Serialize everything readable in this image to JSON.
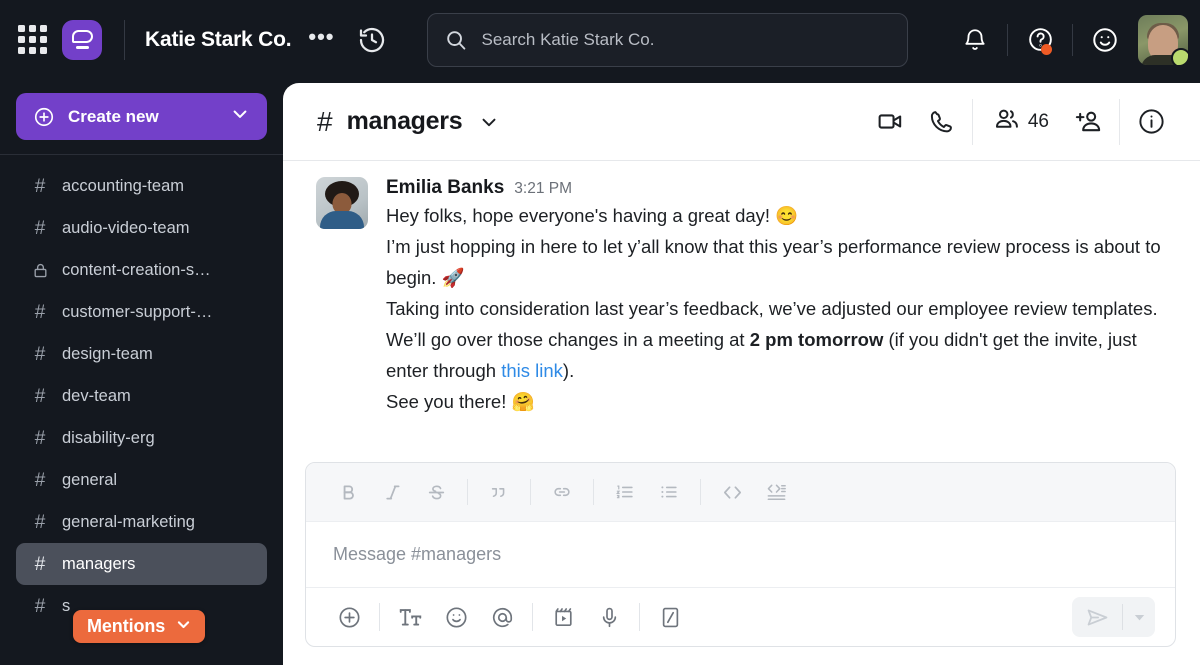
{
  "topbar": {
    "apps_icon": "grid-apps-icon",
    "logo_icon": "brand-chat-logo",
    "org_title": "Katie Stark Co.",
    "more_label": "•••",
    "history_icon": "history-clock-icon",
    "search": {
      "icon": "search-icon",
      "placeholder": "Search Katie Stark Co."
    },
    "notifications_icon": "bell-icon",
    "help_icon": "help-circle-icon",
    "help_has_badge": true,
    "emoji_status_icon": "smiley-face-icon",
    "avatar_icon": "user-avatar",
    "presence_status": "online"
  },
  "sidebar": {
    "create_new": {
      "label": "Create new",
      "plus_icon": "plus-circle-icon",
      "caret_icon": "chevron-down-icon",
      "color": "#7340c9"
    },
    "channels": [
      {
        "name": "accounting-team",
        "icon": "hash-icon",
        "active": false
      },
      {
        "name": "audio-video-team",
        "icon": "hash-icon",
        "active": false
      },
      {
        "name": "content-creation-s…",
        "icon": "lock-icon",
        "active": false
      },
      {
        "name": "customer-support-…",
        "icon": "hash-icon",
        "active": false
      },
      {
        "name": "design-team",
        "icon": "hash-icon",
        "active": false
      },
      {
        "name": "dev-team",
        "icon": "hash-icon",
        "active": false
      },
      {
        "name": "disability-erg",
        "icon": "hash-icon",
        "active": false
      },
      {
        "name": "general",
        "icon": "hash-icon",
        "active": false
      },
      {
        "name": "general-marketing",
        "icon": "hash-icon",
        "active": false
      },
      {
        "name": "managers",
        "icon": "hash-icon",
        "active": true
      },
      {
        "name": "s",
        "icon": "hash-icon",
        "active": false
      }
    ],
    "mentions_pill": {
      "label": "Mentions",
      "caret_icon": "chevron-down-icon",
      "color": "#ec6a3d"
    }
  },
  "channel_header": {
    "hash": "#",
    "name": "managers",
    "caret_icon": "chevron-down-icon",
    "video_icon": "video-camera-icon",
    "call_icon": "phone-icon",
    "members_icon": "people-icon",
    "member_count": "46",
    "add_member_icon": "add-person-icon",
    "info_icon": "info-circle-icon"
  },
  "message": {
    "author": "Emilia Banks",
    "time": "3:21 PM",
    "avatar_icon": "user-avatar",
    "lines": [
      "Hey folks, hope everyone's having a great day! 😊",
      "I’m just hopping in here to let y’all know that this year’s performance review process is about to begin. 🚀",
      "Taking into consideration last year’s feedback, we’ve adjusted our employee review templates. We’ll go over those changes in a meeting at ",
      "2 pm tomorrow",
      " (if you didn't get the invite, just enter through ",
      "this link",
      ").",
      "See you there! 🤗"
    ],
    "link_text": "this link",
    "bold_text": "2 pm tomorrow",
    "link_color": "#2e8ae6"
  },
  "composer": {
    "placeholder": "Message #managers",
    "format_tools": [
      {
        "name": "bold-icon",
        "label": "B"
      },
      {
        "name": "italic-icon",
        "label": "I"
      },
      {
        "name": "strikethrough-icon",
        "label": "S"
      },
      {
        "name": "blockquote-icon",
        "label": "❞"
      },
      {
        "name": "link-icon",
        "label": "🔗"
      },
      {
        "name": "ordered-list-icon",
        "label": "1."
      },
      {
        "name": "bulleted-list-icon",
        "label": "•"
      },
      {
        "name": "inline-code-icon",
        "label": "<>"
      },
      {
        "name": "code-block-icon",
        "label": "</>"
      }
    ],
    "action_tools": [
      {
        "name": "attach-plus-icon"
      },
      {
        "name": "text-format-icon"
      },
      {
        "name": "emoji-icon"
      },
      {
        "name": "mention-icon"
      },
      {
        "name": "video-clip-icon"
      },
      {
        "name": "microphone-icon"
      },
      {
        "name": "slash-command-icon"
      }
    ],
    "send_icon": "send-arrow-icon",
    "send_caret_icon": "chevron-down-icon"
  }
}
